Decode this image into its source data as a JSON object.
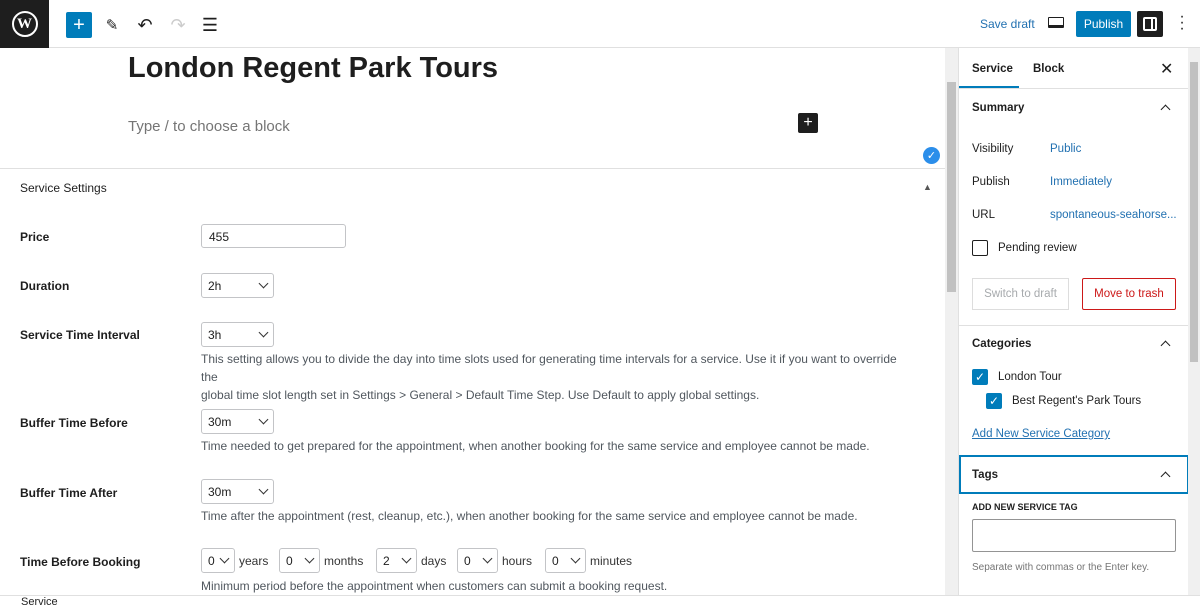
{
  "toolbar": {
    "save_draft": "Save draft",
    "publish": "Publish",
    "icons": [
      "wordpress-logo",
      "plus-icon",
      "pencil-icon",
      "undo-icon",
      "redo-icon",
      "list-view-icon",
      "desktop-preview-icon",
      "sidebar-toggle-icon",
      "more-vertical-icon"
    ]
  },
  "editor": {
    "title": "London Regent Park Tours",
    "placeholder": "Type / to choose a block"
  },
  "meta": {
    "heading": "Service Settings",
    "price": {
      "label": "Price",
      "value": "455"
    },
    "duration": {
      "label": "Duration",
      "value": "2h"
    },
    "interval": {
      "label": "Service Time Interval",
      "value": "3h",
      "desc1": "This setting allows you to divide the day into time slots used for generating time intervals for a service. Use it if you want to override the",
      "desc2": "global time slot length set in Settings > General > Default Time Step. Use Default to apply global settings."
    },
    "buffer_before": {
      "label": "Buffer Time Before",
      "value": "30m",
      "desc": "Time needed to get prepared for the appointment, when another booking for the same service and employee cannot be made."
    },
    "buffer_after": {
      "label": "Buffer Time After",
      "value": "30m",
      "desc": "Time after the appointment (rest, cleanup, etc.), when another booking for the same service and employee cannot be made."
    },
    "before_booking": {
      "label": "Time Before Booking",
      "years": "0",
      "years_label": "years",
      "months": "0",
      "months_label": "months",
      "days": "2",
      "days_label": "days",
      "hours": "0",
      "hours_label": "hours",
      "minutes": "0",
      "minutes_label": "minutes",
      "desc": "Minimum period before the appointment when customers can submit a booking request."
    }
  },
  "sidebar": {
    "tabs": [
      "Service",
      "Block"
    ],
    "summary": {
      "heading": "Summary",
      "visibility_label": "Visibility",
      "visibility": "Public",
      "publish_label": "Publish",
      "publish": "Immediately",
      "url_label": "URL",
      "url": "spontaneous-seahorse...",
      "pending": "Pending review",
      "switch_draft": "Switch to draft",
      "trash": "Move to trash"
    },
    "categories": {
      "heading": "Categories",
      "items": [
        "London Tour",
        "Best Regent's Park Tours"
      ],
      "add": "Add New Service Category"
    },
    "tags": {
      "heading": "Tags",
      "label": "ADD NEW SERVICE TAG",
      "value": "",
      "hint": "Separate with commas or the Enter key."
    }
  },
  "footer": {
    "breadcrumb": "Service"
  },
  "colors": {
    "accent": "#007cba",
    "danger": "#cc1818"
  }
}
